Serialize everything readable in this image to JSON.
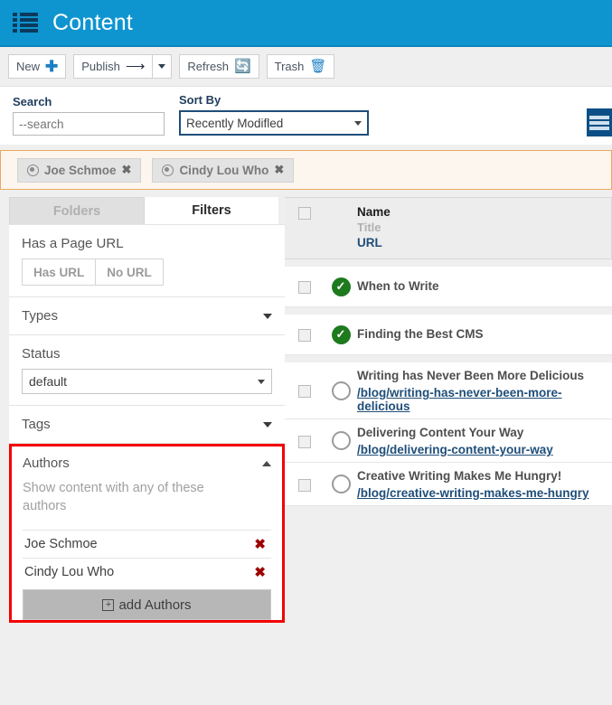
{
  "header": {
    "title": "Content",
    "menu_icon": "hamburger-list-icon",
    "background": "#0e95d0"
  },
  "toolbar": {
    "new_label": "New",
    "new_icon": "plus-icon",
    "publish_label": "Publish",
    "publish_icon": "arrow-right-icon",
    "publish_caret_icon": "caret-down-icon",
    "refresh_label": "Refresh",
    "refresh_icon": "refresh-icon",
    "trash_label": "Trash",
    "trash_icon": "trash-icon"
  },
  "search": {
    "label": "Search",
    "value": "",
    "placeholder": "--search"
  },
  "sort": {
    "label": "Sort By",
    "selected": "Recently Modifled",
    "options": [
      "Recently Modifled"
    ],
    "caret_icon": "caret-down-icon"
  },
  "view_toggle": {
    "icon": "list-view-icon",
    "color": "#0b4f86"
  },
  "active_filter_chips": [
    {
      "label": "Joe Schmoe",
      "icon": "person-icon",
      "remove_icon": "x-icon"
    },
    {
      "label": "Cindy Lou Who",
      "icon": "person-icon",
      "remove_icon": "x-icon"
    }
  ],
  "panel": {
    "tabs": [
      {
        "label": "Folders",
        "active": false
      },
      {
        "label": "Filters",
        "active": true
      }
    ],
    "has_page_url": {
      "title": "Has a Page URL",
      "buttons": [
        "Has URL",
        "No URL"
      ]
    },
    "types": {
      "title": "Types",
      "caret_icon": "caret-down-icon"
    },
    "status": {
      "title": "Status",
      "selected": "default",
      "options": [
        "default"
      ],
      "caret_icon": "caret-down-icon"
    },
    "tags": {
      "title": "Tags",
      "caret_icon": "caret-down-icon"
    },
    "authors": {
      "title": "Authors",
      "collapse_icon": "caret-up-icon",
      "hint": "Show content with any of these authors",
      "items": [
        {
          "name": "Joe Schmoe",
          "remove_icon": "x-icon"
        },
        {
          "name": "Cindy Lou Who",
          "remove_icon": "x-icon"
        }
      ],
      "add_label": "add Authors",
      "add_icon": "plus-box-icon",
      "highlight_color": "#f40000"
    }
  },
  "list": {
    "header": {
      "name": "Name",
      "title": "Title",
      "url": "URL",
      "select_all_checkbox": "unchecked"
    },
    "rows": [
      {
        "title": "When to Write",
        "url": "",
        "status": "published",
        "checked": false
      },
      {
        "title": "Finding the Best CMS",
        "url": "",
        "status": "published",
        "checked": false
      },
      {
        "title": "Writing has Never Been More Delicious",
        "url": "/blog/writing-has-never-been-more-delicious",
        "status": "draft",
        "checked": false
      },
      {
        "title": "Delivering Content Your Way",
        "url": "/blog/delivering-content-your-way",
        "status": "draft",
        "checked": false
      },
      {
        "title": "Creative Writing Makes Me Hungry!",
        "url": "/blog/creative-writing-makes-me-hungry",
        "status": "draft",
        "checked": false
      }
    ]
  }
}
